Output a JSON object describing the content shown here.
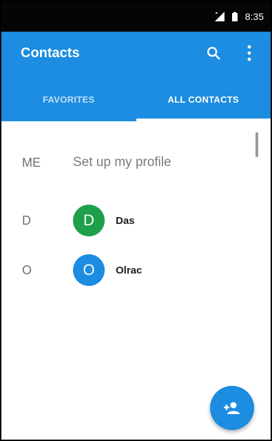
{
  "status_bar": {
    "time": "8:35",
    "icons": [
      "signal-icon",
      "battery-icon"
    ]
  },
  "app_bar": {
    "title": "Contacts",
    "icons": [
      "search-icon",
      "overflow-menu-icon"
    ],
    "color": "#1c8de0"
  },
  "tabs": [
    {
      "label": "FAVORITES",
      "active": false
    },
    {
      "label": "ALL CONTACTS",
      "active": true
    }
  ],
  "profile_row": {
    "section": "ME",
    "text": "Set up my profile"
  },
  "contacts": [
    {
      "section": "D",
      "initial": "D",
      "name": "Das",
      "avatar_color": "#1ea04a"
    },
    {
      "section": "O",
      "initial": "O",
      "name": "Olrac",
      "avatar_color": "#1c8de0"
    }
  ],
  "fab": {
    "icon": "add-contact-icon"
  }
}
